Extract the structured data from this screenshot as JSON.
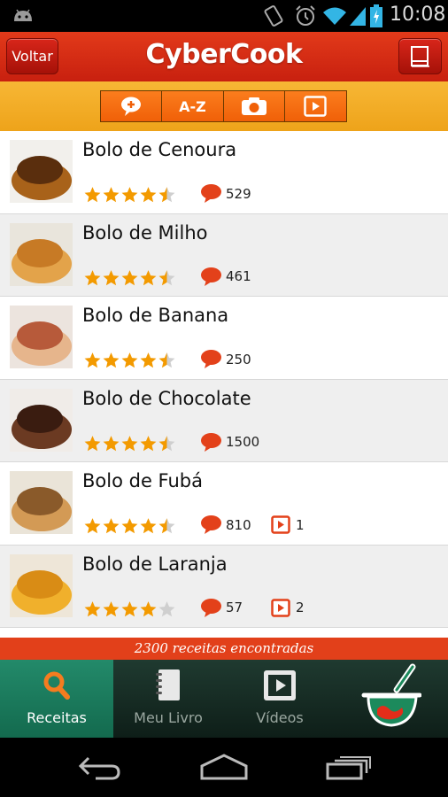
{
  "status_bar": {
    "time": "10:08",
    "icons": [
      "android-icon",
      "screen-rotation-icon",
      "alarm-icon",
      "wifi-icon",
      "signal-icon",
      "battery-charging-icon"
    ]
  },
  "header": {
    "back_label": "Voltar",
    "app_title": "CyberCook",
    "book_icon": "book-icon"
  },
  "toolbar": {
    "tabs": [
      {
        "name": "comment-plus-icon",
        "label": ""
      },
      {
        "name": "az-sort",
        "label": "A-Z"
      },
      {
        "name": "camera-icon",
        "label": ""
      },
      {
        "name": "video-icon",
        "label": ""
      }
    ]
  },
  "recipes": [
    {
      "title": "Bolo de Cenoura",
      "rating": 4.5,
      "comments": "529",
      "videos": ""
    },
    {
      "title": "Bolo de Milho",
      "rating": 4.5,
      "comments": "461",
      "videos": ""
    },
    {
      "title": "Bolo de Banana",
      "rating": 4.5,
      "comments": "250",
      "videos": ""
    },
    {
      "title": "Bolo de Chocolate",
      "rating": 4.5,
      "comments": "1500",
      "videos": ""
    },
    {
      "title": "Bolo de Fubá",
      "rating": 4.5,
      "comments": "810",
      "videos": "1"
    },
    {
      "title": "Bolo de Laranja",
      "rating": 4,
      "comments": "57",
      "videos": "2"
    }
  ],
  "results_text": "2300 receitas encontradas",
  "bottom_nav": {
    "items": [
      {
        "label": "Receitas",
        "icon": "search-icon",
        "active": true
      },
      {
        "label": "Meu Livro",
        "icon": "notebook-icon",
        "active": false
      },
      {
        "label": "Vídeos",
        "icon": "video-icon",
        "active": false
      }
    ],
    "brand_icon": "cooking-pot-icon"
  },
  "colors": {
    "header_red": "#d42a14",
    "toolbar_orange": "#f2a623",
    "star_orange": "#f39a00",
    "comment_red": "#e3411a",
    "nav_green": "#1a7a5c"
  }
}
